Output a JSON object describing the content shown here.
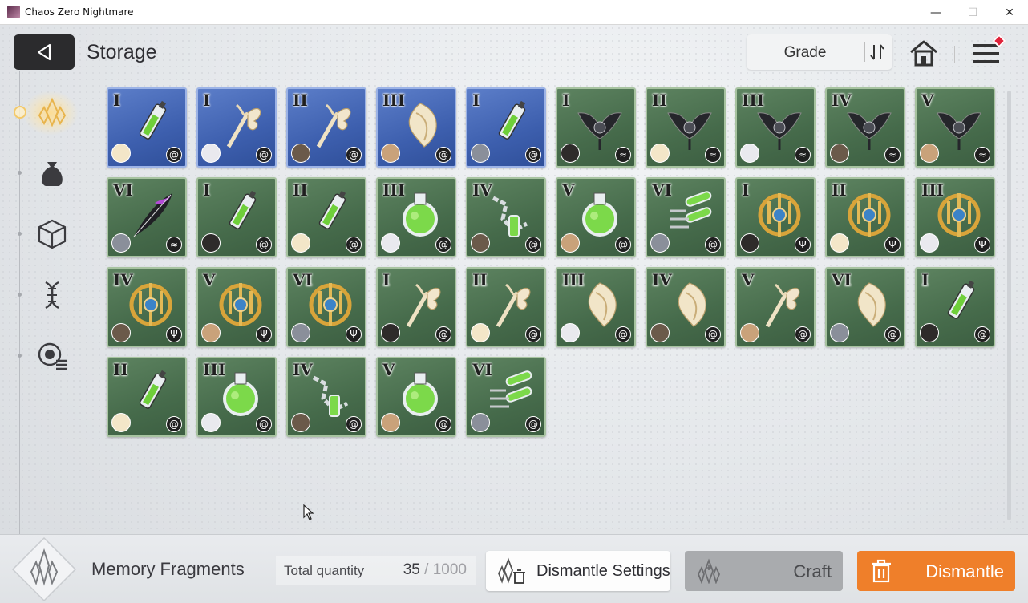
{
  "window": {
    "title": "Chaos Zero Nightmare",
    "min": "—",
    "max": "☐",
    "close": "✕"
  },
  "header": {
    "title": "Storage",
    "sort_label": "Grade"
  },
  "colors": {
    "accent": "#ef7f2a",
    "card_green": "#466b4b",
    "card_blue": "#3d5fae"
  },
  "rail": {
    "items": [
      {
        "name": "memory-fragment-icon",
        "active": true
      },
      {
        "name": "pouch-icon",
        "active": false
      },
      {
        "name": "cube-icon",
        "active": false
      },
      {
        "name": "dna-icon",
        "active": false
      },
      {
        "name": "record-list-icon",
        "active": false
      }
    ]
  },
  "items": [
    {
      "grade": "I",
      "bg": "blue",
      "type": "spiral",
      "art": "syringe"
    },
    {
      "grade": "I",
      "bg": "blue",
      "type": "spiral",
      "art": "staff"
    },
    {
      "grade": "II",
      "bg": "blue",
      "type": "spiral",
      "art": "staff"
    },
    {
      "grade": "III",
      "bg": "blue",
      "type": "spiral",
      "art": "wing"
    },
    {
      "grade": "I",
      "bg": "blue",
      "type": "spiral",
      "art": "syringe"
    },
    {
      "grade": "I",
      "bg": "green",
      "type": "wing",
      "art": "dark"
    },
    {
      "grade": "II",
      "bg": "green",
      "type": "wing",
      "art": "dark"
    },
    {
      "grade": "III",
      "bg": "green",
      "type": "wing",
      "art": "dark"
    },
    {
      "grade": "IV",
      "bg": "green",
      "type": "wing",
      "art": "dark"
    },
    {
      "grade": "V",
      "bg": "green",
      "type": "wing",
      "art": "dark"
    },
    {
      "grade": "VI",
      "bg": "green",
      "type": "wing",
      "art": "feather"
    },
    {
      "grade": "I",
      "bg": "green",
      "type": "spiral",
      "art": "syringe"
    },
    {
      "grade": "II",
      "bg": "green",
      "type": "spiral",
      "art": "syringe"
    },
    {
      "grade": "III",
      "bg": "green",
      "type": "spiral",
      "art": "flask"
    },
    {
      "grade": "IV",
      "bg": "green",
      "type": "spiral",
      "art": "chain"
    },
    {
      "grade": "V",
      "bg": "green",
      "type": "spiral",
      "art": "flask"
    },
    {
      "grade": "VI",
      "bg": "green",
      "type": "spiral",
      "art": "tubes"
    },
    {
      "grade": "I",
      "bg": "green",
      "type": "trident",
      "art": "gold"
    },
    {
      "grade": "II",
      "bg": "green",
      "type": "trident",
      "art": "gold"
    },
    {
      "grade": "III",
      "bg": "green",
      "type": "trident",
      "art": "gold"
    },
    {
      "grade": "IV",
      "bg": "green",
      "type": "trident",
      "art": "gold"
    },
    {
      "grade": "V",
      "bg": "green",
      "type": "trident",
      "art": "gold"
    },
    {
      "grade": "VI",
      "bg": "green",
      "type": "trident",
      "art": "gold"
    },
    {
      "grade": "I",
      "bg": "green",
      "type": "spiral",
      "art": "staff"
    },
    {
      "grade": "II",
      "bg": "green",
      "type": "spiral",
      "art": "staff"
    },
    {
      "grade": "III",
      "bg": "green",
      "type": "spiral",
      "art": "wing"
    },
    {
      "grade": "IV",
      "bg": "green",
      "type": "spiral",
      "art": "wing"
    },
    {
      "grade": "V",
      "bg": "green",
      "type": "spiral",
      "art": "staff"
    },
    {
      "grade": "VI",
      "bg": "green",
      "type": "spiral",
      "art": "wing"
    },
    {
      "grade": "I",
      "bg": "green",
      "type": "spiral",
      "art": "syringe"
    },
    {
      "grade": "II",
      "bg": "green",
      "type": "spiral",
      "art": "syringe"
    },
    {
      "grade": "III",
      "bg": "green",
      "type": "spiral",
      "art": "flask"
    },
    {
      "grade": "IV",
      "bg": "green",
      "type": "spiral",
      "art": "chain"
    },
    {
      "grade": "V",
      "bg": "green",
      "type": "spiral",
      "art": "flask"
    },
    {
      "grade": "VI",
      "bg": "green",
      "type": "spiral",
      "art": "tubes"
    }
  ],
  "bottom": {
    "fragment_name": "Memory Fragments",
    "total_label": "Total quantity",
    "total_value": "35",
    "total_sep": " / ",
    "total_max": "1000",
    "settings_label": "Dismantle Settings",
    "craft_label": "Craft",
    "dismantle_label": "Dismantle"
  }
}
